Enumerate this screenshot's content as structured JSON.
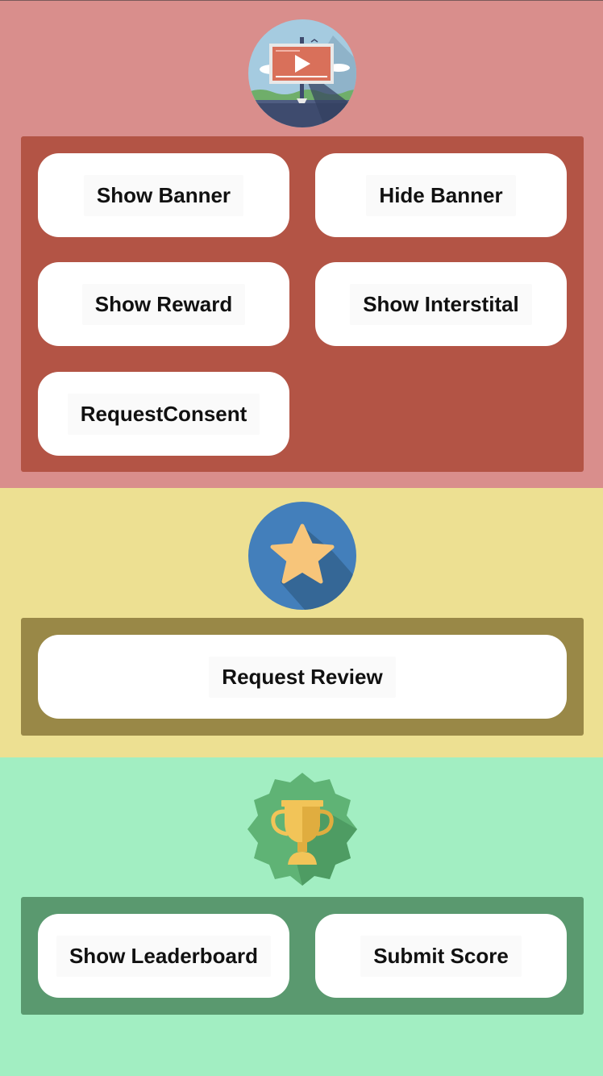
{
  "ads": {
    "icon": "video-billboard-icon",
    "buttons": {
      "show_banner": "Show Banner",
      "hide_banner": "Hide Banner",
      "show_reward": "Show Reward",
      "show_interstitial": "Show Interstital",
      "request_consent": "RequestConsent"
    }
  },
  "review": {
    "icon": "star-icon",
    "buttons": {
      "request_review": "Request Review"
    }
  },
  "games": {
    "icon": "trophy-icon",
    "buttons": {
      "show_leaderboard": "Show Leaderboard",
      "submit_score": "Submit Score"
    }
  },
  "colors": {
    "ads_bg": "#d98e8c",
    "ads_panel": "#b35445",
    "review_bg": "#ede092",
    "review_panel": "#998847",
    "games_bg": "#a2eec2",
    "games_panel": "#5a996f",
    "button_bg": "#ffffff"
  }
}
